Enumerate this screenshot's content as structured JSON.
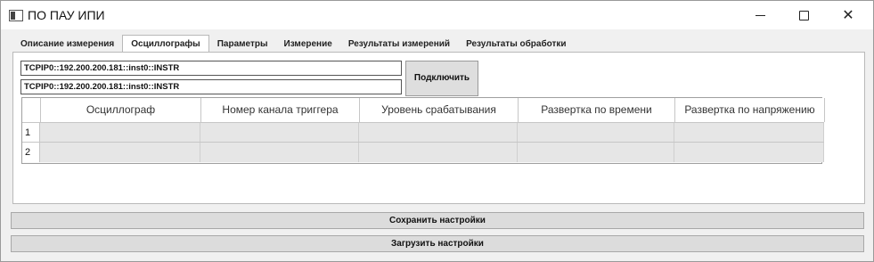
{
  "window": {
    "title": "ПО ПАУ ИПИ",
    "app_icon": "window-app-icon",
    "controls": {
      "minimize_icon": "minimize-icon",
      "maximize_icon": "maximize-icon",
      "close_glyph": "✕"
    }
  },
  "tabs": [
    {
      "label": "Описание измерения",
      "active": false
    },
    {
      "label": "Осциллографы",
      "active": true
    },
    {
      "label": "Параметры",
      "active": false
    },
    {
      "label": "Измерение",
      "active": false
    },
    {
      "label": "Результаты измерений",
      "active": false
    },
    {
      "label": "Результаты обработки",
      "active": false
    }
  ],
  "oscilloscopes": {
    "addresses": [
      "TCPIP0::192.200.200.181::inst0::INSTR",
      "TCPIP0::192.200.200.181::inst0::INSTR"
    ],
    "connect_label": "Подключить",
    "table": {
      "columns": [
        "Осциллограф",
        "Номер канала триггера",
        "Уровень срабатывания",
        "Развертка по времени",
        "Развертка по напряжению"
      ],
      "rows": [
        {
          "index": "1",
          "cells": [
            "",
            "",
            "",
            "",
            ""
          ]
        },
        {
          "index": "2",
          "cells": [
            "",
            "",
            "",
            "",
            ""
          ]
        }
      ]
    }
  },
  "footer": {
    "save_label": "Сохранить настройки",
    "load_label": "Загрузить настройки"
  }
}
